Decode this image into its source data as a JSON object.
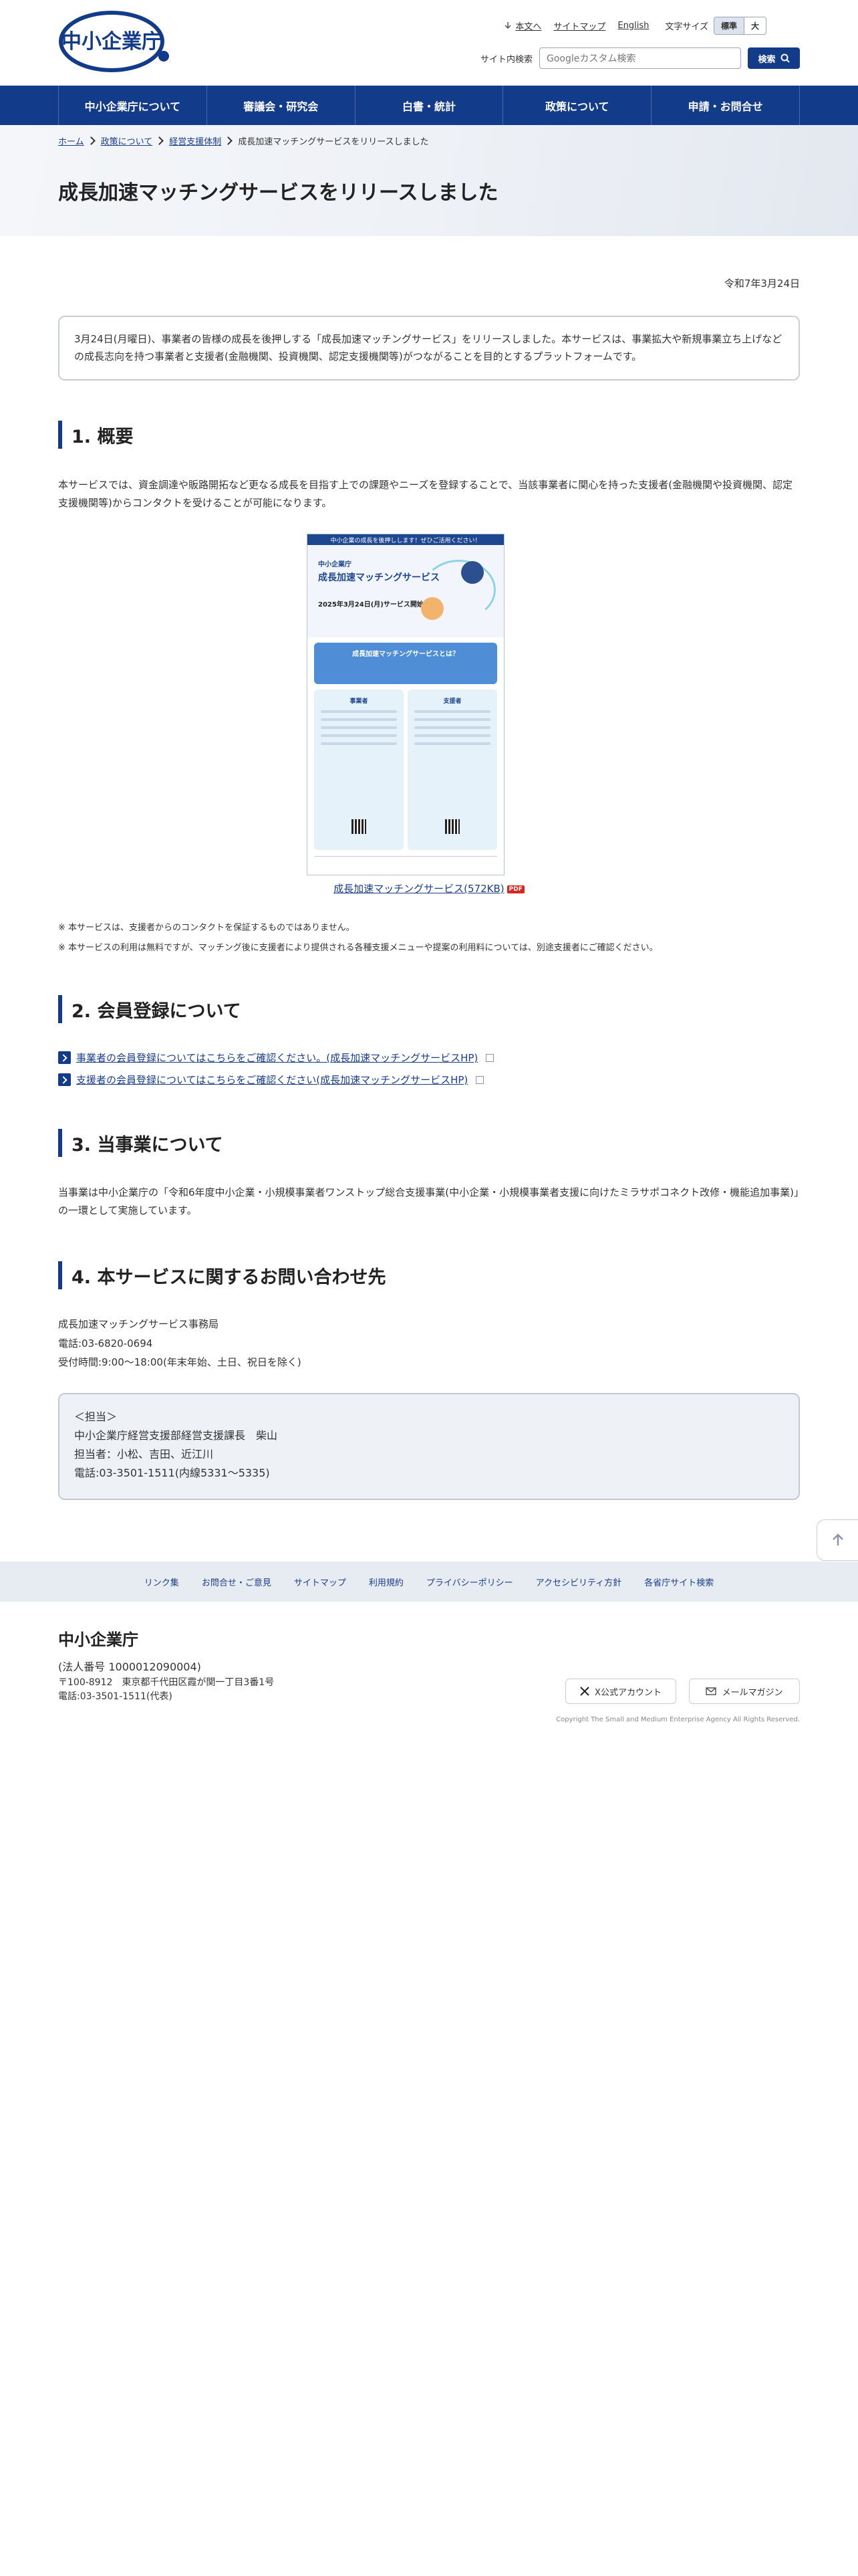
{
  "header": {
    "logo_text": "中小企業庁",
    "links": [
      "本文へ",
      "サイトマップ",
      "English"
    ],
    "font_size_label": "文字サイズ",
    "font_size_options": [
      "標準",
      "大"
    ],
    "search_label": "サイト内検索",
    "search_placeholder": "Googleカスタム検索",
    "search_button": "検索"
  },
  "nav": [
    "中小企業庁について",
    "審議会・研究会",
    "白書・統計",
    "政策について",
    "申請・お問合せ"
  ],
  "breadcrumb": [
    "ホーム",
    "政策について",
    "経営支援体制",
    "成長加速マッチングサービスをリリースしました"
  ],
  "page_title": "成長加速マッチングサービスをリリースしました",
  "date": "令和7年3月24日",
  "lead": "3月24日(月曜日)、事業者の皆様の成長を後押しする「成長加速マッチングサービス」をリリースしました。本サービスは、事業拡大や新規事業立ち上げなどの成長志向を持つ事業者と支援者(金融機関、投資機関、認定支援機関等)がつながることを目的とするプラットフォームです。",
  "sections": {
    "s1": {
      "title": "1. 概要",
      "body": "本サービスでは、資金調達や販路開拓など更なる成長を目指す上での課題やニーズを登録することで、当該事業者に関心を持った支援者(金融機関や投資機関、認定支援機関等)からコンタクトを受けることが可能になります。",
      "flyer": {
        "top": "中小企業の成長を後押しします！ぜひご活用ください！",
        "agency": "中小企業庁",
        "name": "成長加速マッチングサービス",
        "start": "2025年3月24日(月)サービス開始",
        "band": "成長加速マッチングサービスとは？",
        "col1": "事業者",
        "col2": "支援者"
      },
      "file_link": "成長加速マッチングサービス(572KB)",
      "pdf": "PDF",
      "notes": [
        "※ 本サービスは、支援者からのコンタクトを保証するものではありません。",
        "※ 本サービスの利用は無料ですが、マッチング後に支援者により提供される各種支援メニューや提案の利用料については、別途支援者にご確認ください。"
      ]
    },
    "s2": {
      "title": "2. 会員登録について",
      "links": [
        "事業者の会員登録についてはこちらをご確認ください。(成長加速マッチングサービスHP)",
        "支援者の会員登録についてはこちらをご確認ください(成長加速マッチングサービスHP)"
      ]
    },
    "s3": {
      "title": "3. 当事業について",
      "body": "当事業は中小企業庁の「令和6年度中小企業・小規模事業者ワンストップ総合支援事業(中小企業・小規模事業者支援に向けたミラサポコネクト改修・機能追加事業)」の一環として実施しています。"
    },
    "s4": {
      "title": "4. 本サービスに関するお問い合わせ先",
      "lines": [
        "成長加速マッチングサービス事務局",
        "電話:03-6820-0694",
        "受付時間:9:00～18:00(年末年始、土日、祝日を除く)"
      ],
      "box": [
        "＜担当＞",
        "中小企業庁経営支援部経営支援課長　柴山",
        "担当者：小松、吉田、近江川",
        "電話:03-3501-1511(内線5331～5335)"
      ]
    }
  },
  "footer": {
    "nav": [
      "リンク集",
      "お問合せ・ご意見",
      "サイトマップ",
      "利用規約",
      "プライバシーポリシー",
      "アクセシビリティ方針",
      "各省庁サイト検索"
    ],
    "name": "中小企業庁",
    "corp_no": "(法人番号 1000012090004)",
    "address": "〒100-8912　東京都千代田区霞が関一丁目3番1号",
    "tel": "電話:03-3501-1511(代表)",
    "x_button": "X公式アカウント",
    "mail_button": "メールマガジン",
    "copyright": "Copyright The Small and Medium Enterprise Agency All Rights Reserved."
  },
  "colors": {
    "brand_navy": "#123b8a",
    "link": "#1a3e8c",
    "pdf_red": "#d9251c"
  }
}
